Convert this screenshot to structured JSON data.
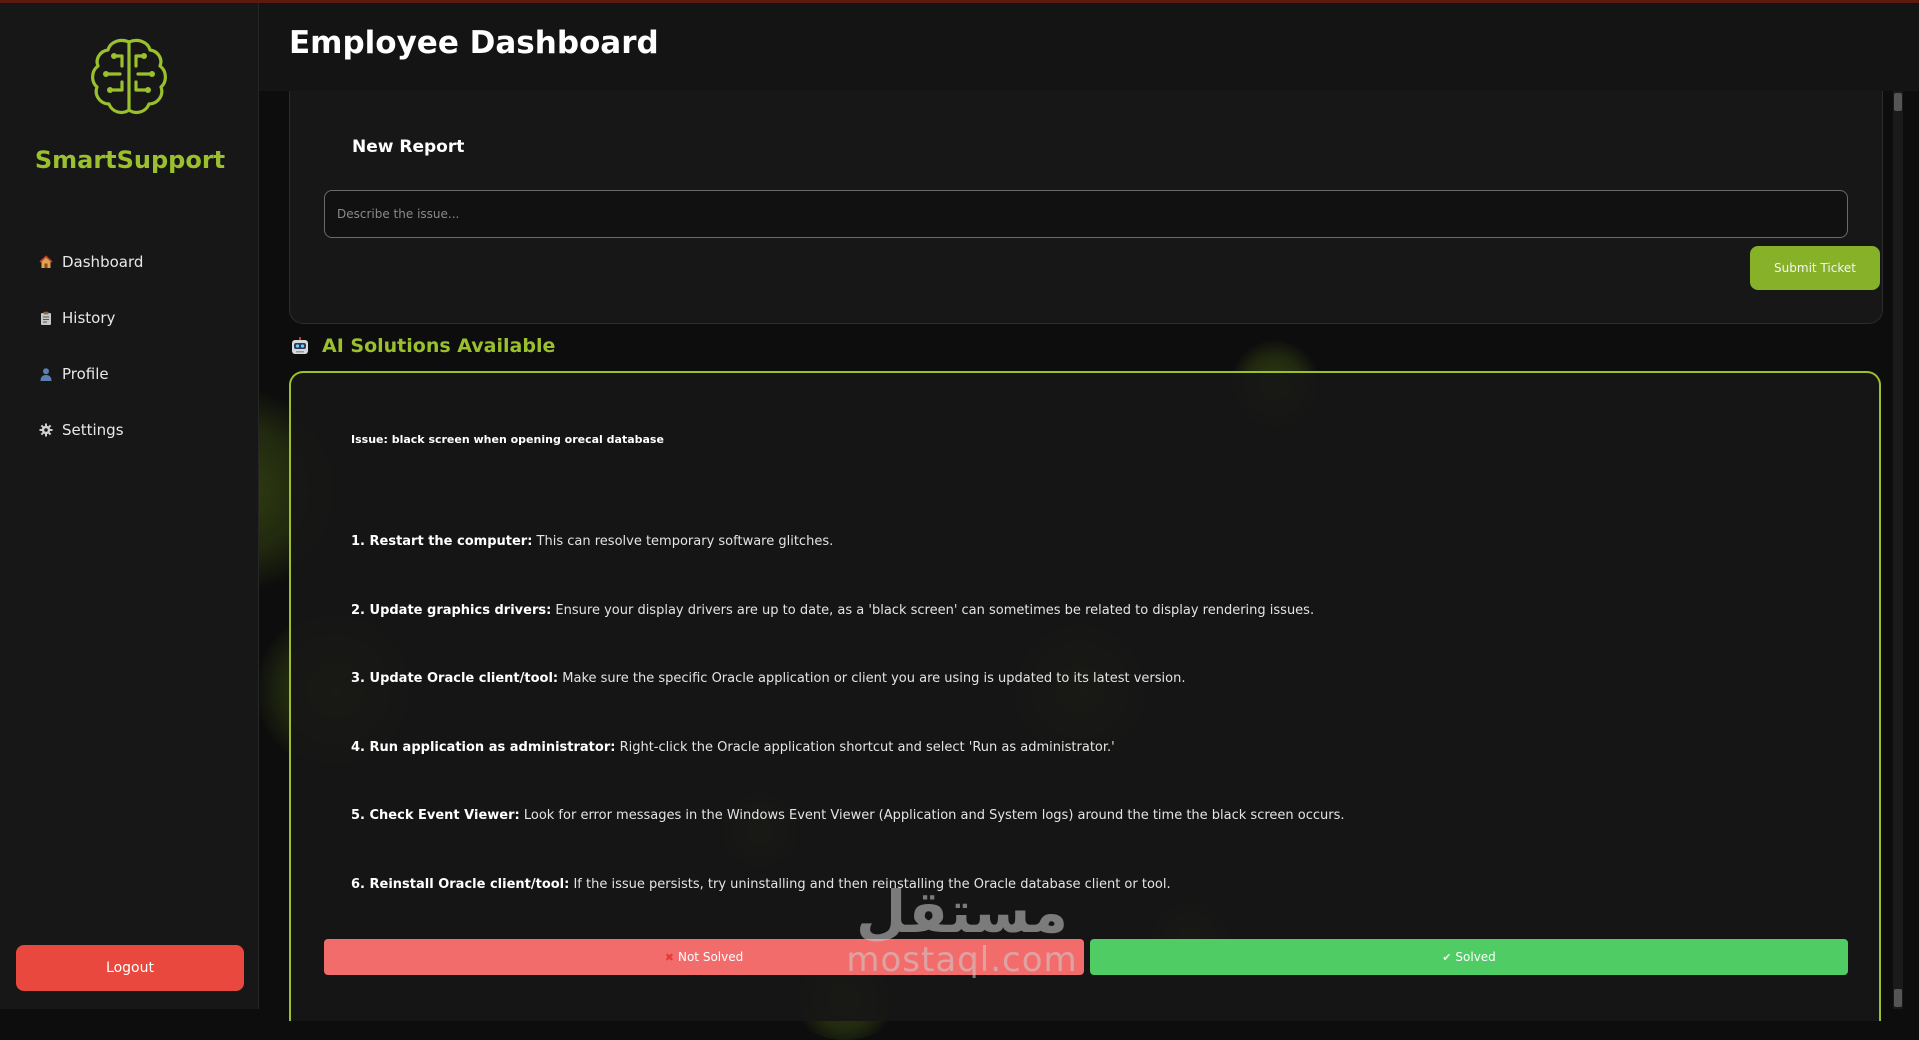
{
  "sidebar": {
    "brand": "SmartSupport",
    "nav": [
      {
        "label": "Dashboard",
        "icon": "house-icon"
      },
      {
        "label": "History",
        "icon": "clipboard-icon"
      },
      {
        "label": "Profile",
        "icon": "user-icon"
      },
      {
        "label": "Settings",
        "icon": "gear-icon"
      }
    ],
    "logout_label": "Logout"
  },
  "header": {
    "title": "Employee Dashboard"
  },
  "report": {
    "title": "New Report",
    "input_placeholder": "Describe the issue...",
    "input_value": "",
    "submit_label": "Submit Ticket"
  },
  "ai": {
    "heading": "AI Solutions Available",
    "heading_icon": "robot-icon",
    "issue": "Issue: black screen when opening orecal database",
    "steps": [
      {
        "title": "1. Restart the computer:",
        "text": " This can resolve temporary software glitches."
      },
      {
        "title": "2. Update graphics drivers:",
        "text": " Ensure your display drivers are up to date, as a 'black screen' can sometimes be related to display rendering issues."
      },
      {
        "title": "3. Update Oracle client/tool:",
        "text": " Make sure the specific Oracle application or client you are using is updated to its latest version."
      },
      {
        "title": "4. Run application as administrator:",
        "text": " Right-click the Oracle application shortcut and select 'Run as administrator.'"
      },
      {
        "title": "5. Check Event Viewer:",
        "text": " Look for error messages in the Windows Event Viewer (Application and System logs) around the time the black screen occurs."
      },
      {
        "title": "6. Reinstall Oracle client/tool:",
        "text": " If the issue persists, try uninstalling and then reinstalling the Oracle database client or tool."
      }
    ],
    "not_solved_label": "Not Solved",
    "not_solved_icon": "cross-mark-icon",
    "solved_label": "Solved",
    "solved_icon": "check-mark-icon"
  },
  "watermark": {
    "arabic": "مستقل",
    "latin": "mostaql.com"
  },
  "colors": {
    "accent": "#9ac02d",
    "submit": "#86b128",
    "logout": "#e8483e",
    "not_solved": "#f36c6c",
    "solved": "#4fcc63",
    "background": "#0d0d0d"
  }
}
